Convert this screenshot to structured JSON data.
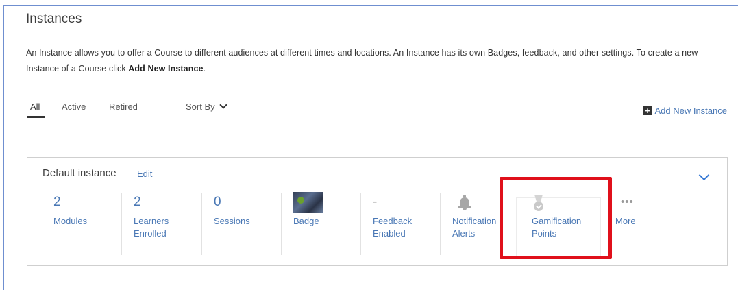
{
  "page": {
    "title": "Instances",
    "description_pre": "An Instance allows you to offer a Course to different audiences at different times and locations. An Instance has its own Badges, feedback, and other settings. To create a new Instance of a Course click ",
    "description_bold": "Add New Instance",
    "description_post": "."
  },
  "tabs": [
    {
      "label": "All",
      "active": true
    },
    {
      "label": "Active",
      "active": false
    },
    {
      "label": "Retired",
      "active": false
    }
  ],
  "sort": {
    "label": "Sort By"
  },
  "add_new": {
    "label": "Add New Instance",
    "icon": "plus-square-icon"
  },
  "instance": {
    "title": "Default instance",
    "edit_label": "Edit",
    "stats": [
      {
        "value": "2",
        "label": "Modules"
      },
      {
        "value": "2",
        "label": "Learners\nEnrolled"
      },
      {
        "value": "0",
        "label": "Sessions"
      },
      {
        "value": "",
        "label": "Badge",
        "icon": "badge-image"
      },
      {
        "value": "-",
        "label": "Feedback\nEnabled"
      },
      {
        "value": "",
        "label": "Notification\nAlerts",
        "icon": "bell-icon"
      },
      {
        "value": "",
        "label": "Gamification\nPoints",
        "icon": "medal-icon"
      },
      {
        "value": "",
        "label": "More",
        "icon": "ellipsis-icon"
      }
    ]
  },
  "colors": {
    "link": "#4a78b5",
    "highlight": "#e0101b",
    "icon_gray": "#a7a7a7"
  }
}
